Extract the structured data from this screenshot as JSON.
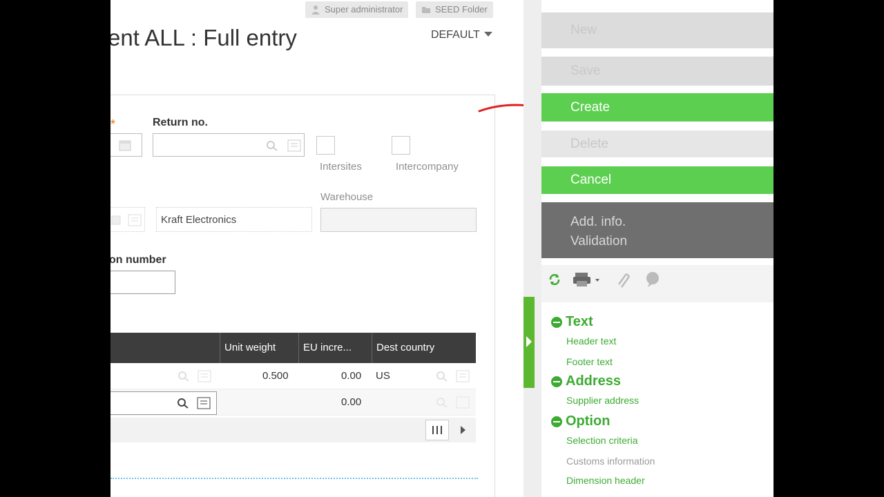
{
  "header": {
    "badges": [
      "Super administrator",
      "SEED Folder"
    ],
    "title": "ent ALL : Full entry",
    "view_selector": "DEFAULT"
  },
  "form": {
    "return_no_label": "Return no.",
    "required_mark": "*",
    "intersites_label": "Intersites",
    "intercompany_label": "Intercompany",
    "warehouse_label": "Warehouse",
    "supplier_name": "Kraft Electronics",
    "partial_label": "on number"
  },
  "grid": {
    "columns": [
      "Unit weight",
      "EU incre...",
      "Dest country"
    ],
    "rows": [
      {
        "unit_weight": "0.500",
        "eu_incre": "0.00",
        "dest_country": "US"
      },
      {
        "unit_weight": "",
        "eu_incre": "0.00",
        "dest_country": ""
      }
    ]
  },
  "actions": {
    "new": "New",
    "save": "Save",
    "create": "Create",
    "delete": "Delete",
    "cancel": "Cancel",
    "add_info_line1": "Add. info.",
    "add_info_line2": "Validation"
  },
  "sections": {
    "text": {
      "title": "Text",
      "links": [
        "Header text",
        "Footer text"
      ]
    },
    "address": {
      "title": "Address",
      "links": [
        "Supplier address"
      ]
    },
    "option": {
      "title": "Option",
      "links": [
        "Selection criteria",
        "Customs information",
        "Dimension header"
      ]
    }
  },
  "colors": {
    "accent_green": "#5dcf50",
    "section_green": "#3cab32",
    "dark_button": "#6f6f6f",
    "annotation_red": "#e02020"
  },
  "icons": [
    "user-icon",
    "folder-icon",
    "calendar-icon",
    "search-icon",
    "list-icon",
    "refresh-icon",
    "print-icon",
    "attach-icon",
    "comment-icon",
    "column-settings-icon",
    "scroll-right-icon"
  ]
}
